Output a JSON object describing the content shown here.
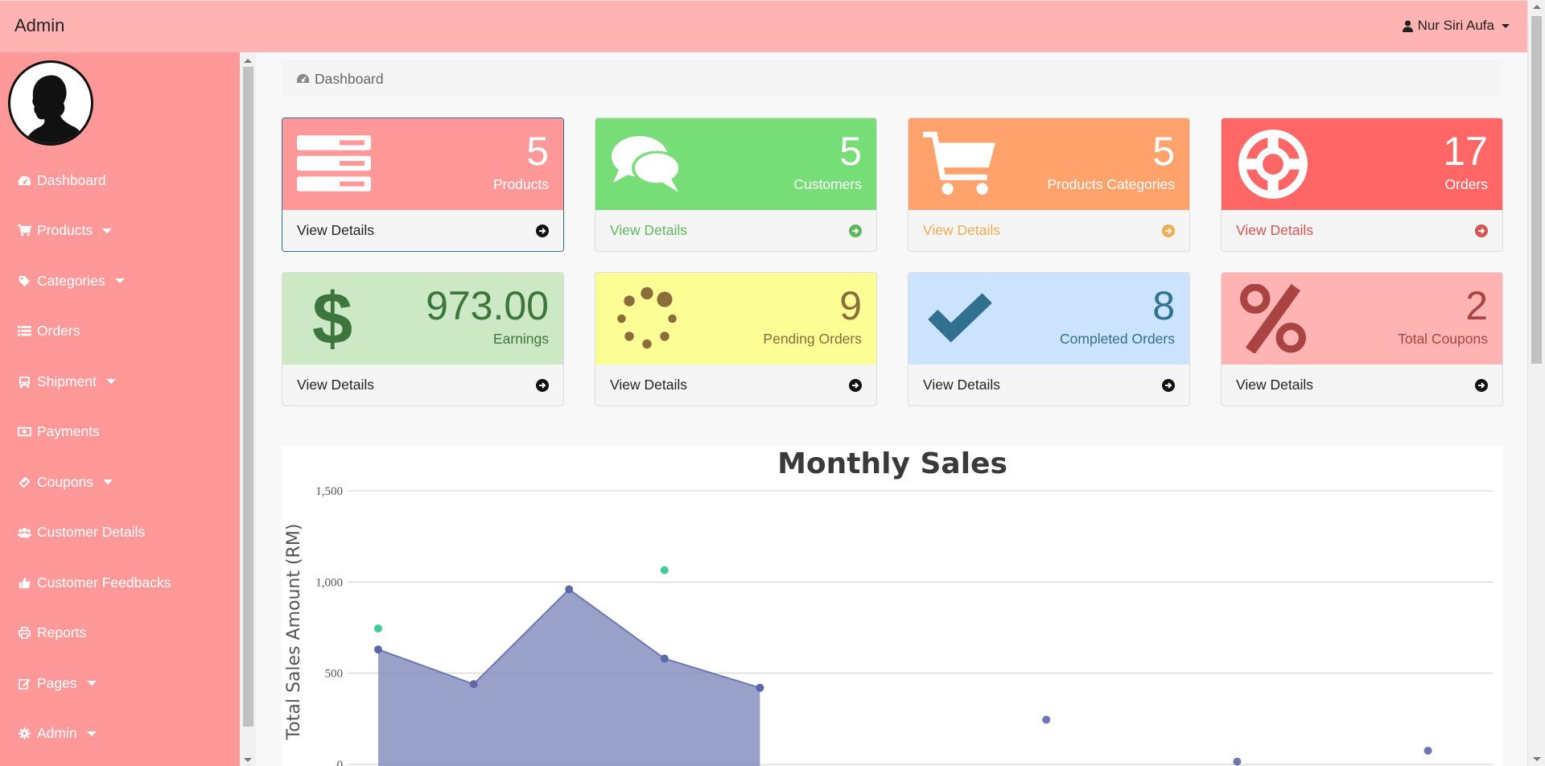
{
  "app": {
    "brand": "Admin"
  },
  "user": {
    "name": "Nur Siri Aufa"
  },
  "sidebar": {
    "items": [
      {
        "label": "Dashboard",
        "icon": "dashboard-icon",
        "dropdown": false
      },
      {
        "label": "Products",
        "icon": "cart-icon",
        "dropdown": true
      },
      {
        "label": "Categories",
        "icon": "tag-icon",
        "dropdown": true
      },
      {
        "label": "Orders",
        "icon": "list-icon",
        "dropdown": false
      },
      {
        "label": "Shipment",
        "icon": "bus-icon",
        "dropdown": true
      },
      {
        "label": "Payments",
        "icon": "money-icon",
        "dropdown": false
      },
      {
        "label": "Coupons",
        "icon": "ticket-icon",
        "dropdown": true
      },
      {
        "label": "Customer Details",
        "icon": "users-icon",
        "dropdown": false
      },
      {
        "label": "Customer Feedbacks",
        "icon": "thumbs-up-icon",
        "dropdown": false
      },
      {
        "label": "Reports",
        "icon": "print-icon",
        "dropdown": false
      },
      {
        "label": "Pages",
        "icon": "edit-icon",
        "dropdown": true
      },
      {
        "label": "Admin",
        "icon": "gear-icon",
        "dropdown": true
      }
    ]
  },
  "breadcrumb": {
    "label": "Dashboard"
  },
  "cards": [
    {
      "value": "5",
      "label": "Products",
      "link": "View Details",
      "icon": "server-icon",
      "head_color": "#ff9999",
      "text_color": "#ffffff",
      "link_color": "#222222"
    },
    {
      "value": "5",
      "label": "Customers",
      "link": "View Details",
      "icon": "comments-icon",
      "head_color": "#77dd77",
      "text_color": "#ffffff",
      "link_color": "#5cb85c"
    },
    {
      "value": "5",
      "label": "Products Categories",
      "link": "View Details",
      "icon": "shopping-cart-icon",
      "head_color": "#ffa26b",
      "text_color": "#ffffff",
      "link_color": "#f0ad4e"
    },
    {
      "value": "17",
      "label": "Orders",
      "link": "View Details",
      "icon": "life-ring-icon",
      "head_color": "#ff6666",
      "text_color": "#ffffff",
      "link_color": "#d9534f"
    },
    {
      "value": "973.00",
      "label": "Earnings",
      "link": "View Details",
      "icon": "dollar-icon",
      "head_color": "#cde8c4",
      "text_color": "#3c763d",
      "link_color": "#222222"
    },
    {
      "value": "9",
      "label": "Pending Orders",
      "link": "View Details",
      "icon": "spinner-icon",
      "head_color": "#fdfd96",
      "text_color": "#8a6d3b",
      "link_color": "#222222"
    },
    {
      "value": "8",
      "label": "Completed Orders",
      "link": "View Details",
      "icon": "check-icon",
      "head_color": "#cce3ff",
      "text_color": "#31708f",
      "link_color": "#222222"
    },
    {
      "value": "2",
      "label": "Total Coupons",
      "link": "View Details",
      "icon": "percent-icon",
      "head_color": "#ffb3b3",
      "text_color": "#a94442",
      "link_color": "#222222"
    }
  ],
  "chart_data": {
    "type": "area",
    "title": "Monthly Sales",
    "ylabel": "Total Sales Amount (RM)",
    "xlabel": "",
    "ylim": [
      0,
      1500
    ],
    "yticks": [
      "0",
      "500",
      "1,000",
      "1,500"
    ],
    "grid": true,
    "series": [
      {
        "type": "area",
        "color": "#7c87b8",
        "points": [
          [
            1,
            630
          ],
          [
            2,
            440
          ],
          [
            3,
            960
          ],
          [
            4,
            580
          ],
          [
            5,
            420
          ]
        ]
      },
      {
        "type": "scatter",
        "color": "#6b78b5",
        "points": [
          [
            8,
            245
          ],
          [
            10,
            15
          ],
          [
            12,
            75
          ]
        ]
      },
      {
        "type": "scatter",
        "color": "#3ec99a",
        "points": [
          [
            1,
            745
          ],
          [
            4,
            1065
          ]
        ]
      }
    ]
  }
}
